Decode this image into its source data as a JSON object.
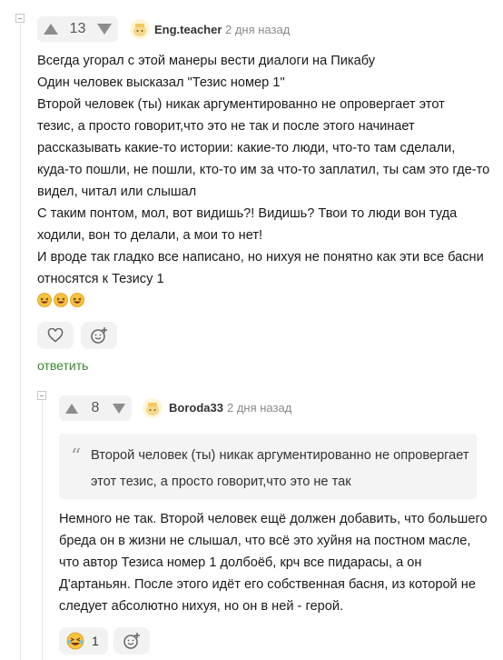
{
  "colors": {
    "accent": "#3a8a2f",
    "muted": "#8a8a8a",
    "panel": "#f2f2f2"
  },
  "comment1": {
    "rating": "13",
    "username": "Eng.teacher",
    "time": "2 дня назад",
    "lines": [
      "Всегда угорал с этой манеры вести диалоги на Пикабу",
      "Один человек высказал \"Тезис номер 1\"",
      "Второй человек (ты) никак аргументированно не опровергает этот",
      "тезис, а просто говорит,что это не так и после этого начинает",
      "рассказывать какие-то истории: какие-то люди, что-то там сделали,",
      "куда-то пошли, не пошли, кто-то им за что-то заплатил, ты сам это где-то",
      "видел, читал или слышал",
      "С таким понтом, мол, вот видишь?! Видишь? Твои то люди вон туда",
      "ходили, вон то делали, а мои то нет!",
      "И вроде так гладко все написано, но нихуя не понятно как эти все басни",
      "относятся к Тезису 1"
    ],
    "emojis": [
      "laughing-face-emoji",
      "laughing-face-emoji",
      "laughing-face-emoji"
    ],
    "reply": "ответить"
  },
  "comment2": {
    "rating": "8",
    "username": "Boroda33",
    "time": "2 дня назад",
    "quote_lines": [
      "Второй человек (ты) никак аргументированно не опровергает",
      "этот тезис, а просто говорит,что это не так"
    ],
    "lines": [
      "Немного не так. Второй человек ещё должен добавить, что большего",
      "бреда он в жизни не слышал, что всё это хуйня на постном масле,",
      "что автор Тезиса номер 1 долбоёб, крч все пидарасы, а он",
      "Д'артаньян. После этого идёт его собственная басня, из которой не",
      "следует абсолютно нихуя, но он в ней - герой."
    ],
    "reaction_count": "1"
  }
}
